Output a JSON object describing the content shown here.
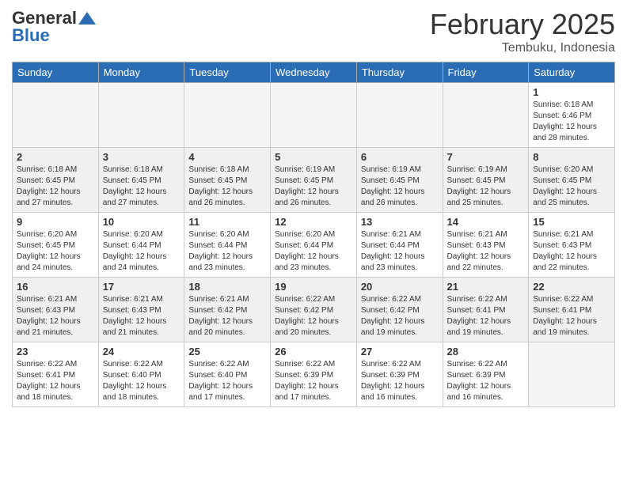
{
  "logo": {
    "line1": "General",
    "line2": "Blue"
  },
  "title": "February 2025",
  "location": "Tembuku, Indonesia",
  "headers": [
    "Sunday",
    "Monday",
    "Tuesday",
    "Wednesday",
    "Thursday",
    "Friday",
    "Saturday"
  ],
  "rows": [
    {
      "shaded": false,
      "cells": [
        {
          "empty": true,
          "day": "",
          "info": ""
        },
        {
          "empty": true,
          "day": "",
          "info": ""
        },
        {
          "empty": true,
          "day": "",
          "info": ""
        },
        {
          "empty": true,
          "day": "",
          "info": ""
        },
        {
          "empty": true,
          "day": "",
          "info": ""
        },
        {
          "empty": true,
          "day": "",
          "info": ""
        },
        {
          "empty": false,
          "day": "1",
          "info": "Sunrise: 6:18 AM\nSunset: 6:46 PM\nDaylight: 12 hours\nand 28 minutes."
        }
      ]
    },
    {
      "shaded": true,
      "cells": [
        {
          "empty": false,
          "day": "2",
          "info": "Sunrise: 6:18 AM\nSunset: 6:45 PM\nDaylight: 12 hours\nand 27 minutes."
        },
        {
          "empty": false,
          "day": "3",
          "info": "Sunrise: 6:18 AM\nSunset: 6:45 PM\nDaylight: 12 hours\nand 27 minutes."
        },
        {
          "empty": false,
          "day": "4",
          "info": "Sunrise: 6:18 AM\nSunset: 6:45 PM\nDaylight: 12 hours\nand 26 minutes."
        },
        {
          "empty": false,
          "day": "5",
          "info": "Sunrise: 6:19 AM\nSunset: 6:45 PM\nDaylight: 12 hours\nand 26 minutes."
        },
        {
          "empty": false,
          "day": "6",
          "info": "Sunrise: 6:19 AM\nSunset: 6:45 PM\nDaylight: 12 hours\nand 26 minutes."
        },
        {
          "empty": false,
          "day": "7",
          "info": "Sunrise: 6:19 AM\nSunset: 6:45 PM\nDaylight: 12 hours\nand 25 minutes."
        },
        {
          "empty": false,
          "day": "8",
          "info": "Sunrise: 6:20 AM\nSunset: 6:45 PM\nDaylight: 12 hours\nand 25 minutes."
        }
      ]
    },
    {
      "shaded": false,
      "cells": [
        {
          "empty": false,
          "day": "9",
          "info": "Sunrise: 6:20 AM\nSunset: 6:45 PM\nDaylight: 12 hours\nand 24 minutes."
        },
        {
          "empty": false,
          "day": "10",
          "info": "Sunrise: 6:20 AM\nSunset: 6:44 PM\nDaylight: 12 hours\nand 24 minutes."
        },
        {
          "empty": false,
          "day": "11",
          "info": "Sunrise: 6:20 AM\nSunset: 6:44 PM\nDaylight: 12 hours\nand 23 minutes."
        },
        {
          "empty": false,
          "day": "12",
          "info": "Sunrise: 6:20 AM\nSunset: 6:44 PM\nDaylight: 12 hours\nand 23 minutes."
        },
        {
          "empty": false,
          "day": "13",
          "info": "Sunrise: 6:21 AM\nSunset: 6:44 PM\nDaylight: 12 hours\nand 23 minutes."
        },
        {
          "empty": false,
          "day": "14",
          "info": "Sunrise: 6:21 AM\nSunset: 6:43 PM\nDaylight: 12 hours\nand 22 minutes."
        },
        {
          "empty": false,
          "day": "15",
          "info": "Sunrise: 6:21 AM\nSunset: 6:43 PM\nDaylight: 12 hours\nand 22 minutes."
        }
      ]
    },
    {
      "shaded": true,
      "cells": [
        {
          "empty": false,
          "day": "16",
          "info": "Sunrise: 6:21 AM\nSunset: 6:43 PM\nDaylight: 12 hours\nand 21 minutes."
        },
        {
          "empty": false,
          "day": "17",
          "info": "Sunrise: 6:21 AM\nSunset: 6:43 PM\nDaylight: 12 hours\nand 21 minutes."
        },
        {
          "empty": false,
          "day": "18",
          "info": "Sunrise: 6:21 AM\nSunset: 6:42 PM\nDaylight: 12 hours\nand 20 minutes."
        },
        {
          "empty": false,
          "day": "19",
          "info": "Sunrise: 6:22 AM\nSunset: 6:42 PM\nDaylight: 12 hours\nand 20 minutes."
        },
        {
          "empty": false,
          "day": "20",
          "info": "Sunrise: 6:22 AM\nSunset: 6:42 PM\nDaylight: 12 hours\nand 19 minutes."
        },
        {
          "empty": false,
          "day": "21",
          "info": "Sunrise: 6:22 AM\nSunset: 6:41 PM\nDaylight: 12 hours\nand 19 minutes."
        },
        {
          "empty": false,
          "day": "22",
          "info": "Sunrise: 6:22 AM\nSunset: 6:41 PM\nDaylight: 12 hours\nand 19 minutes."
        }
      ]
    },
    {
      "shaded": false,
      "cells": [
        {
          "empty": false,
          "day": "23",
          "info": "Sunrise: 6:22 AM\nSunset: 6:41 PM\nDaylight: 12 hours\nand 18 minutes."
        },
        {
          "empty": false,
          "day": "24",
          "info": "Sunrise: 6:22 AM\nSunset: 6:40 PM\nDaylight: 12 hours\nand 18 minutes."
        },
        {
          "empty": false,
          "day": "25",
          "info": "Sunrise: 6:22 AM\nSunset: 6:40 PM\nDaylight: 12 hours\nand 17 minutes."
        },
        {
          "empty": false,
          "day": "26",
          "info": "Sunrise: 6:22 AM\nSunset: 6:39 PM\nDaylight: 12 hours\nand 17 minutes."
        },
        {
          "empty": false,
          "day": "27",
          "info": "Sunrise: 6:22 AM\nSunset: 6:39 PM\nDaylight: 12 hours\nand 16 minutes."
        },
        {
          "empty": false,
          "day": "28",
          "info": "Sunrise: 6:22 AM\nSunset: 6:39 PM\nDaylight: 12 hours\nand 16 minutes."
        },
        {
          "empty": true,
          "day": "",
          "info": ""
        }
      ]
    }
  ]
}
